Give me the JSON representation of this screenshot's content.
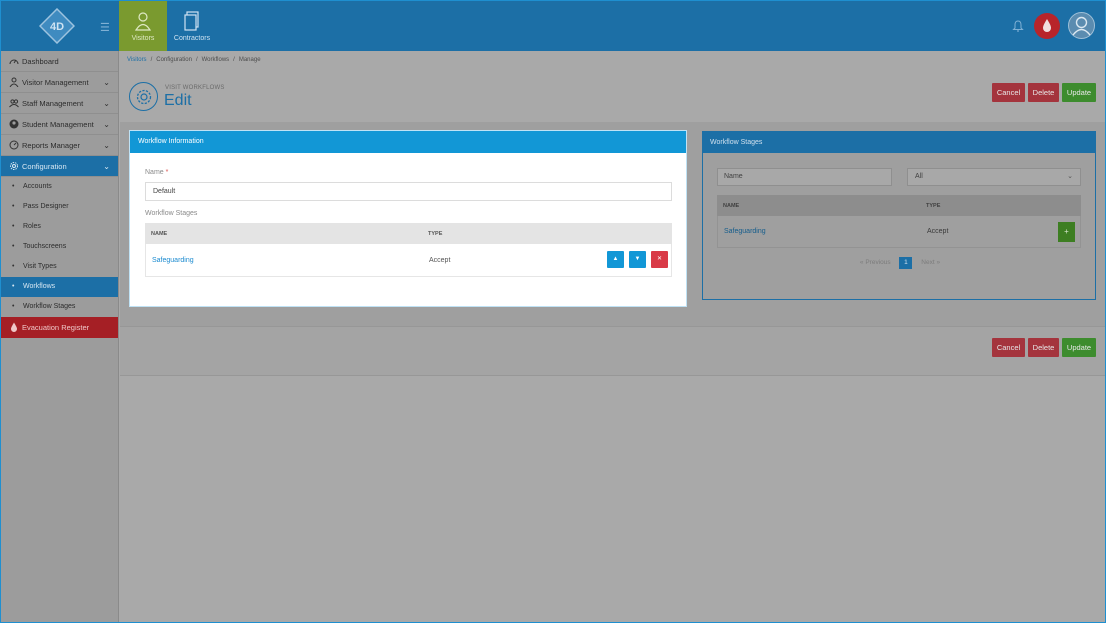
{
  "topbar": {
    "tabs": [
      {
        "label": "Visitors",
        "icon": "person-icon",
        "active": true
      },
      {
        "label": "Contractors",
        "icon": "document-icon",
        "active": false
      }
    ]
  },
  "sidebar": {
    "items": [
      {
        "label": "Dashboard",
        "icon": "dashboard-icon"
      },
      {
        "label": "Visitor Management",
        "icon": "person-icon"
      },
      {
        "label": "Staff Management",
        "icon": "users-icon"
      },
      {
        "label": "Student Management",
        "icon": "student-icon"
      },
      {
        "label": "Reports Manager",
        "icon": "gauge-icon"
      },
      {
        "label": "Configuration",
        "icon": "gear-icon",
        "active": true
      }
    ],
    "sub_items": [
      {
        "label": "Accounts"
      },
      {
        "label": "Pass Designer"
      },
      {
        "label": "Roles"
      },
      {
        "label": "Touchscreens"
      },
      {
        "label": "Visit Types"
      },
      {
        "label": "Workflows",
        "active": true
      },
      {
        "label": "Workflow Stages"
      }
    ],
    "evacuation": {
      "label": "Evacuation Register",
      "icon": "drop-icon",
      "color": "#a51f25"
    }
  },
  "breadcrumb": [
    "Visitors",
    "Configuration",
    "Workflows",
    "Manage"
  ],
  "header": {
    "subtitle": "VISIT WORKFLOWS",
    "title": "Edit"
  },
  "actions": {
    "cancel": "Cancel",
    "delete": "Delete",
    "update": "Update"
  },
  "workflow_info": {
    "title": "Workflow Information",
    "name_label": "Name",
    "required_mark": "*",
    "name_value": "Default",
    "stages_label": "Workflow Stages",
    "columns": [
      "NAME",
      "TYPE"
    ],
    "rows": [
      {
        "name": "Safeguarding",
        "type": "Accept"
      }
    ]
  },
  "workflow_stages": {
    "title": "Workflow Stages",
    "search_placeholder": "Name",
    "filter_value": "All",
    "columns": [
      "NAME",
      "TYPE"
    ],
    "rows": [
      {
        "name": "Safeguarding",
        "type": "Accept"
      }
    ],
    "pager": {
      "prev": "Previous",
      "current": "1",
      "next": "Next"
    }
  },
  "colors": {
    "primary": "#1c6fa6",
    "accent_blue": "#1297d6",
    "danger": "#d93a47",
    "success": "#3d8c2e"
  }
}
